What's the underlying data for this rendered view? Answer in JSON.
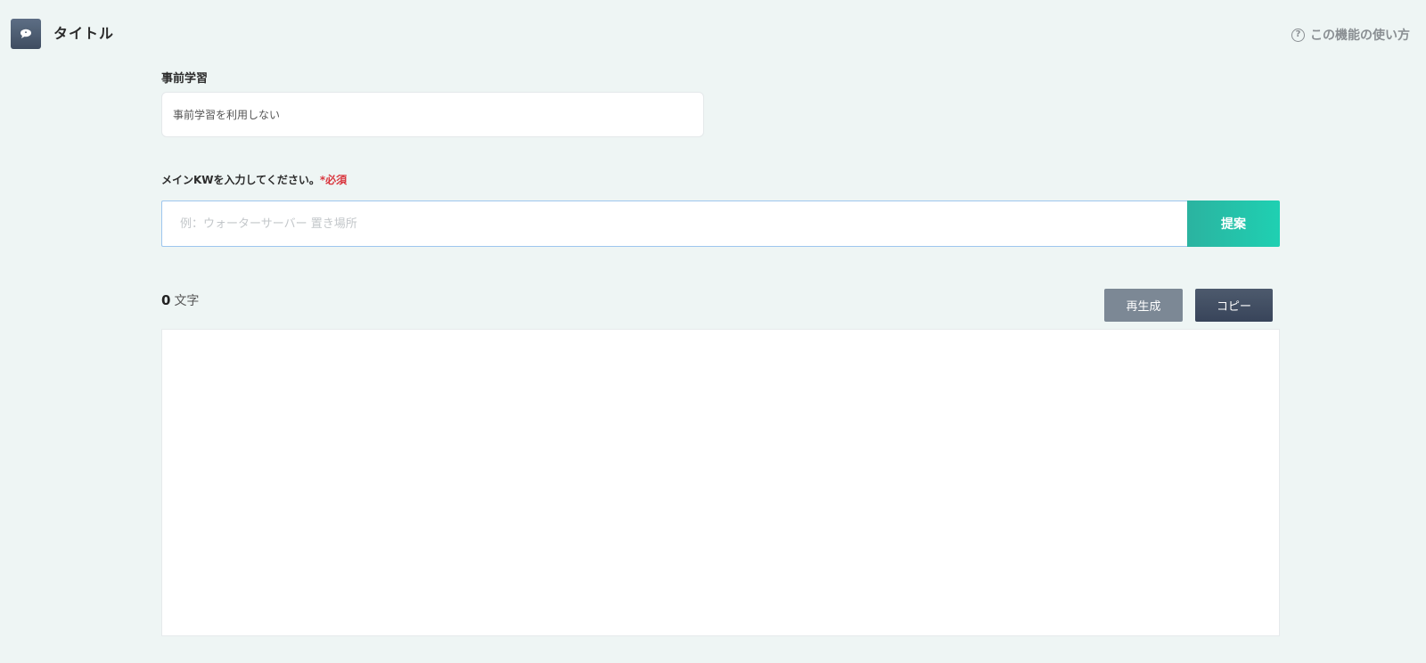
{
  "header": {
    "title": "タイトル",
    "icon": "speech-bubble-icon",
    "help_label": "この機能の使い方",
    "help_icon": "question-circle-icon"
  },
  "pretraining": {
    "label": "事前学習",
    "selected_value": "事前学習を利用しない"
  },
  "keyword": {
    "label": "メインKWを入力してください。",
    "required_mark": "*必須",
    "placeholder": "例：ウォーターサーバー 置き場所",
    "value": "",
    "submit_label": "提案"
  },
  "output": {
    "char_count": "0",
    "char_unit": "文字",
    "regenerate_label": "再生成",
    "copy_label": "コピー",
    "text": ""
  },
  "colors": {
    "background": "#eef5f4",
    "accent": "#1fd0b2",
    "required": "#d9363e",
    "regenerate_button": "#7c8895",
    "copy_button": "#38445a"
  }
}
